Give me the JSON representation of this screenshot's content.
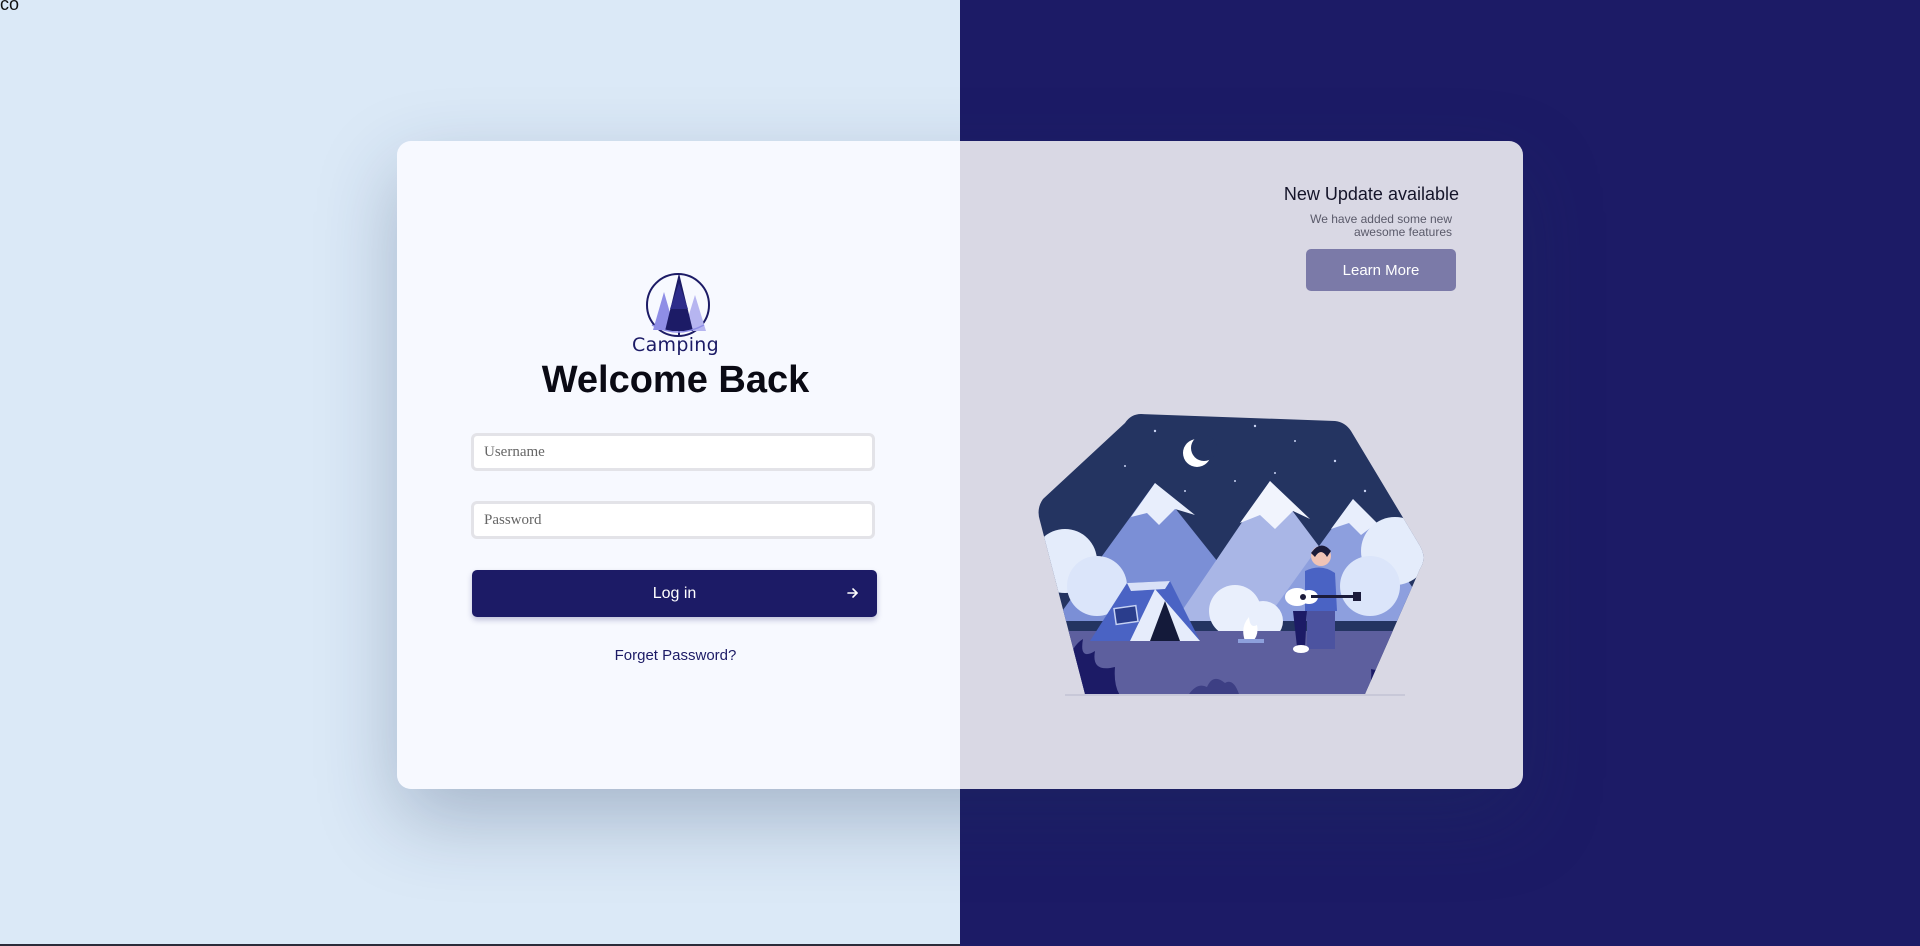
{
  "page": {
    "corner_text": "co"
  },
  "login": {
    "brand": "Camping",
    "welcome": "Welcome Back",
    "username_placeholder": "Username",
    "password_placeholder": "Password",
    "login_label": "Log in",
    "forget_label": "Forget Password?"
  },
  "update": {
    "title": "New Update available",
    "subtitle": "We have added some new awesome features",
    "button_label": "Learn More"
  },
  "icons": {
    "logo": "pine-tree-logo-icon",
    "login_arrow": "arrow-right-icon",
    "illustration": "camping-illustration"
  },
  "colors": {
    "bg_left": "#dbe9f7",
    "bg_right": "#1c1b66",
    "card_left": "#f7f9ff",
    "card_right": "#d9d8e4",
    "primary": "#1c1b66",
    "learn_more": "#7b7aa8"
  }
}
